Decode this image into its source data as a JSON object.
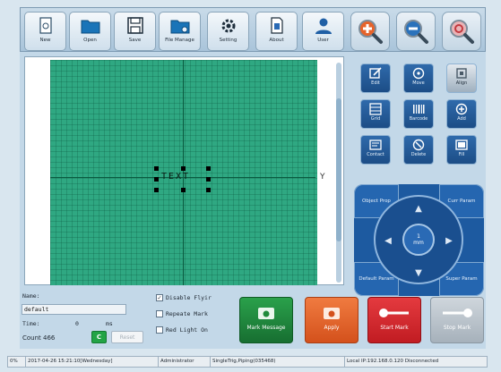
{
  "toolbar": {
    "buttons": [
      {
        "label": "New",
        "icon": "new-file-icon"
      },
      {
        "label": "Open",
        "icon": "folder-icon"
      },
      {
        "label": "Save",
        "icon": "floppy-icon"
      },
      {
        "label": "File Manage",
        "icon": "file-manage-icon"
      },
      {
        "label": "Setting",
        "icon": "gear-icon"
      },
      {
        "label": "About",
        "icon": "document-icon"
      },
      {
        "label": "User",
        "icon": "user-icon"
      }
    ],
    "zoom_in_icon": "zoom-in-icon",
    "zoom_out_icon": "zoom-out-icon",
    "zoom_fit_icon": "zoom-reset-icon"
  },
  "canvas": {
    "mark_text": "TEXT",
    "axis_arrow": "Y"
  },
  "right_panel": {
    "buttons": [
      {
        "label": "Edit",
        "icon": "edit-icon"
      },
      {
        "label": "Move",
        "icon": "move-icon"
      },
      {
        "label": "Align",
        "icon": "align-icon"
      },
      {
        "label": "Grid",
        "icon": "grid-icon"
      },
      {
        "label": "Barcode",
        "icon": "barcode-icon"
      },
      {
        "label": "Add",
        "icon": "add-icon"
      },
      {
        "label": "Contact",
        "icon": "contact-icon"
      },
      {
        "label": "Delete",
        "icon": "delete-icon"
      },
      {
        "label": "Fill",
        "icon": "fill-icon"
      }
    ],
    "dpad": {
      "top_left": "Object Prop",
      "top_right": "Curr Param",
      "bottom_left": "Default Param",
      "bottom_right": "Super Param",
      "center_value": "1",
      "center_unit": "mm"
    }
  },
  "info": {
    "name_label": "Name:",
    "name_value": "default",
    "time_label": "Time:",
    "time_value": "0",
    "time_unit": "ms",
    "count_label": "Count 466",
    "count_clear": "C",
    "reset_label": "Reset"
  },
  "options": [
    {
      "label": "Disable Flyir",
      "checked": true
    },
    {
      "label": "Repeate Mark",
      "checked": false
    },
    {
      "label": "Red Light On",
      "checked": false
    }
  ],
  "actions": {
    "mark_message": "Mark Message",
    "apply": "Apply",
    "start_mark": "Start Mark",
    "stop_mark": "Stop Mark"
  },
  "status_bar": {
    "progress": "0%",
    "datetime": "2017-04-26 15:21:10[Wednesday]",
    "user": "Administrator",
    "mode": "SingleTrig,Piping(035468)",
    "network": "Local IP:192.168.0.120 Disconnected"
  },
  "colors": {
    "canvas_green": "#2fa882",
    "panel_blue": "#1d5aa0",
    "mark_message_green": "#1f8a3a",
    "apply_orange": "#e5622a",
    "start_mark_red": "#d6262b",
    "stop_mark_gray": "#b9c2ca"
  }
}
